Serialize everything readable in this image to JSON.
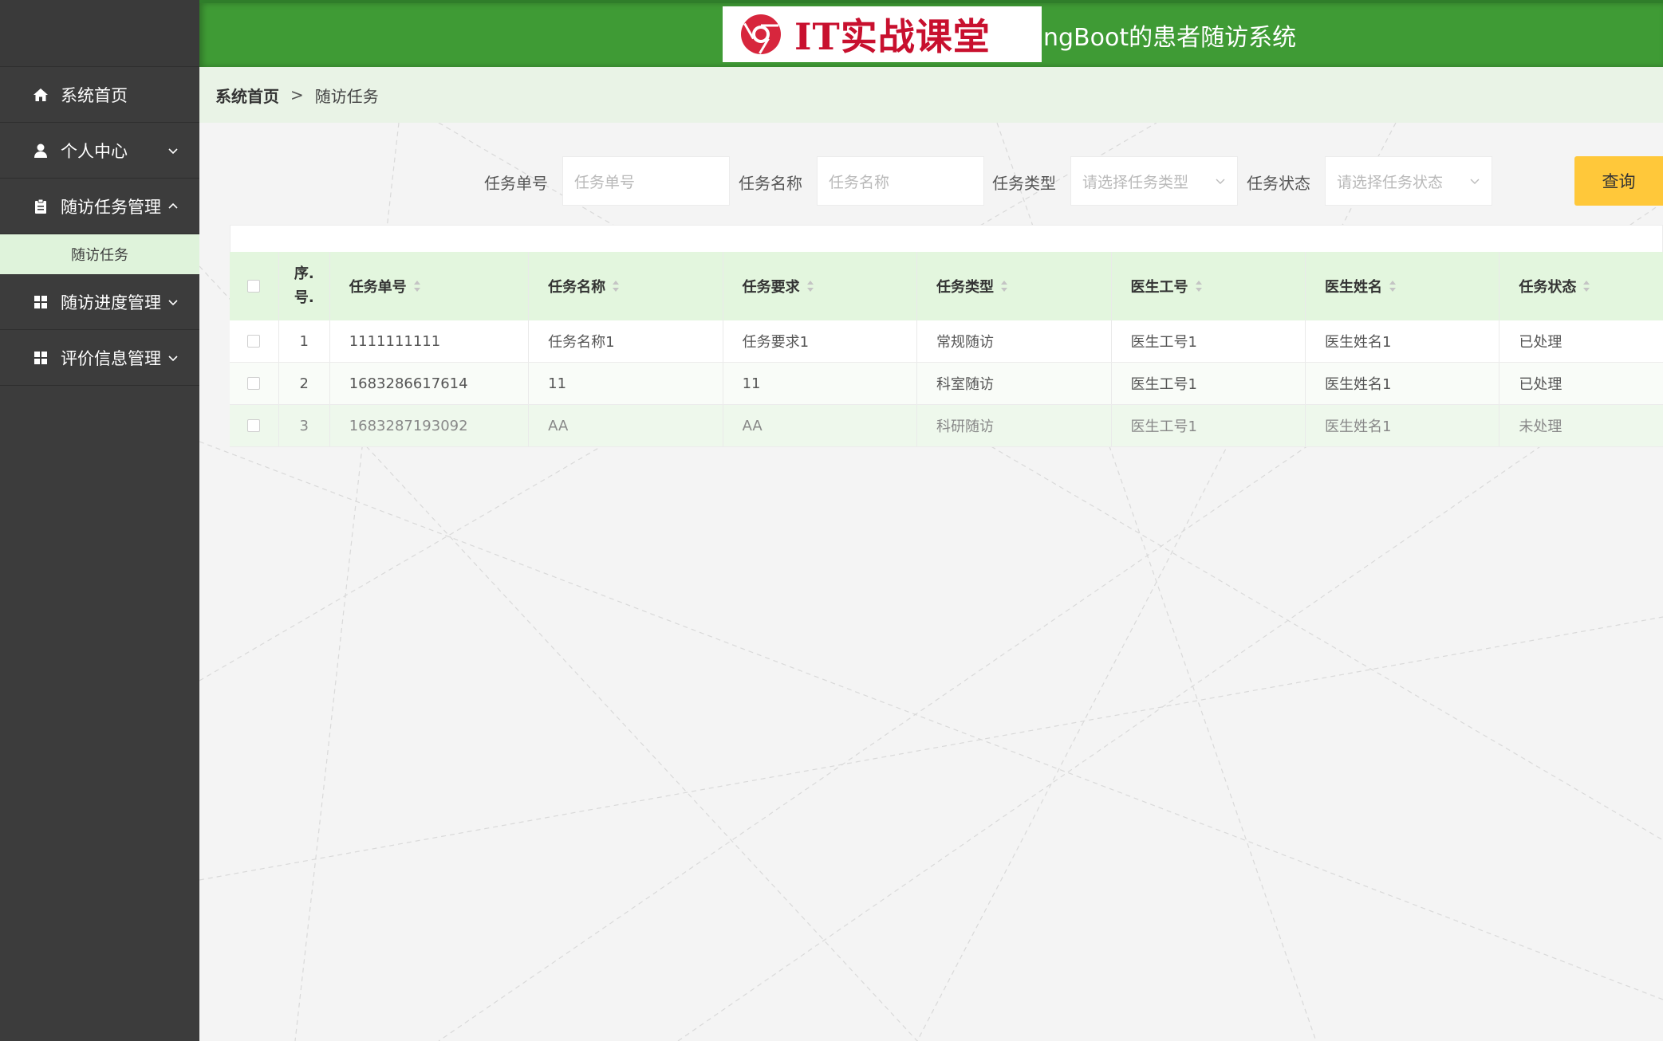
{
  "header": {
    "logo_text": "IT实战课堂",
    "title": "ngBoot的患者随访系统"
  },
  "sidebar": {
    "items": [
      {
        "label": "系统首页",
        "icon": "home-icon"
      },
      {
        "label": "个人中心",
        "icon": "user-icon"
      },
      {
        "label": "随访任务管理",
        "icon": "clipboard-icon"
      },
      {
        "label": "随访进度管理",
        "icon": "grid-icon"
      },
      {
        "label": "评价信息管理",
        "icon": "grid-icon"
      }
    ],
    "submenu": {
      "label": "随访任务"
    }
  },
  "breadcrumb": {
    "home": "系统首页",
    "separator": ">",
    "current": "随访任务"
  },
  "search": {
    "fields": [
      {
        "label": "任务单号",
        "placeholder": "任务单号"
      },
      {
        "label": "任务名称",
        "placeholder": "任务名称"
      },
      {
        "label": "任务类型",
        "placeholder": "请选择任务类型"
      },
      {
        "label": "任务状态",
        "placeholder": "请选择任务状态"
      }
    ],
    "query_label": "查询"
  },
  "table": {
    "columns": [
      "序.",
      "号.",
      "任务单号",
      "任务名称",
      "任务要求",
      "任务类型",
      "医生工号",
      "医生姓名",
      "任务状态"
    ],
    "rows": [
      {
        "idx": "1",
        "no": "1111111111",
        "name": "任务名称1",
        "req": "任务要求1",
        "type": "常规随访",
        "doc_no": "医生工号1",
        "doc_name": "医生姓名1",
        "status": "已处理"
      },
      {
        "idx": "2",
        "no": "1683286617614",
        "name": "11",
        "req": "11",
        "type": "科室随访",
        "doc_no": "医生工号1",
        "doc_name": "医生姓名1",
        "status": "已处理"
      },
      {
        "idx": "3",
        "no": "1683287193092",
        "name": "AA",
        "req": "AA",
        "type": "科研随访",
        "doc_no": "医生工号1",
        "doc_name": "医生姓名1",
        "status": "未处理"
      }
    ]
  },
  "colors": {
    "header_green": "#3f9b35",
    "sidebar_bg": "#3c3c3c",
    "submenu_bg": "#dff3db",
    "table_head_bg": "#e3f6de",
    "query_button": "#ffc83a",
    "logo_red": "#c8102e"
  }
}
